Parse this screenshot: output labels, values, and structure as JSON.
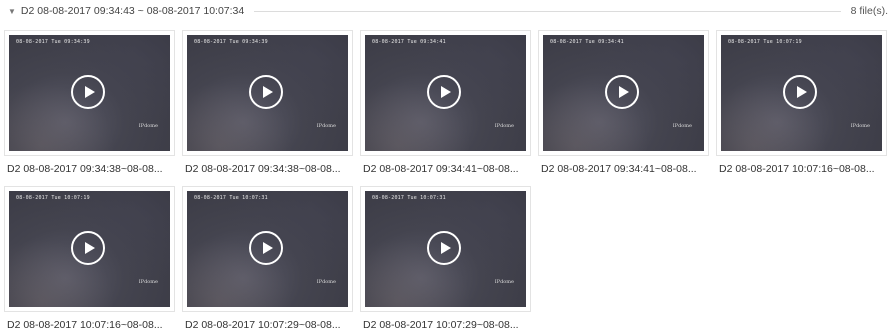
{
  "group": {
    "caret": "▼",
    "title": "D2 08-08-2017 09:34:43 ~ 08-08-2017 10:07:34",
    "count": "8 file(s)."
  },
  "files": [
    {
      "caption": "D2 08-08-2017 09:34:38~08-08...",
      "osd_time": "08-08-2017 Tue 09:34:39",
      "osd_cam": "IPdome"
    },
    {
      "caption": "D2 08-08-2017 09:34:38~08-08...",
      "osd_time": "08-08-2017 Tue 09:34:39",
      "osd_cam": "IPdome"
    },
    {
      "caption": "D2 08-08-2017 09:34:41~08-08...",
      "osd_time": "08-08-2017 Tue 09:34:41",
      "osd_cam": "IPdome"
    },
    {
      "caption": "D2 08-08-2017 09:34:41~08-08...",
      "osd_time": "08-08-2017 Tue 09:34:41",
      "osd_cam": "IPdome"
    },
    {
      "caption": "D2 08-08-2017 10:07:16~08-08...",
      "osd_time": "08-08-2017 Tue 10:07:19",
      "osd_cam": "IPdome"
    },
    {
      "caption": "D2 08-08-2017 10:07:16~08-08...",
      "osd_time": "08-08-2017 Tue 10:07:19",
      "osd_cam": "IPdome"
    },
    {
      "caption": "D2 08-08-2017 10:07:29~08-08...",
      "osd_time": "08-08-2017 Tue 10:07:31",
      "osd_cam": "IPdome"
    },
    {
      "caption": "D2 08-08-2017 10:07:29~08-08...",
      "osd_time": "08-08-2017 Tue 10:07:31",
      "osd_cam": "IPdome"
    }
  ]
}
